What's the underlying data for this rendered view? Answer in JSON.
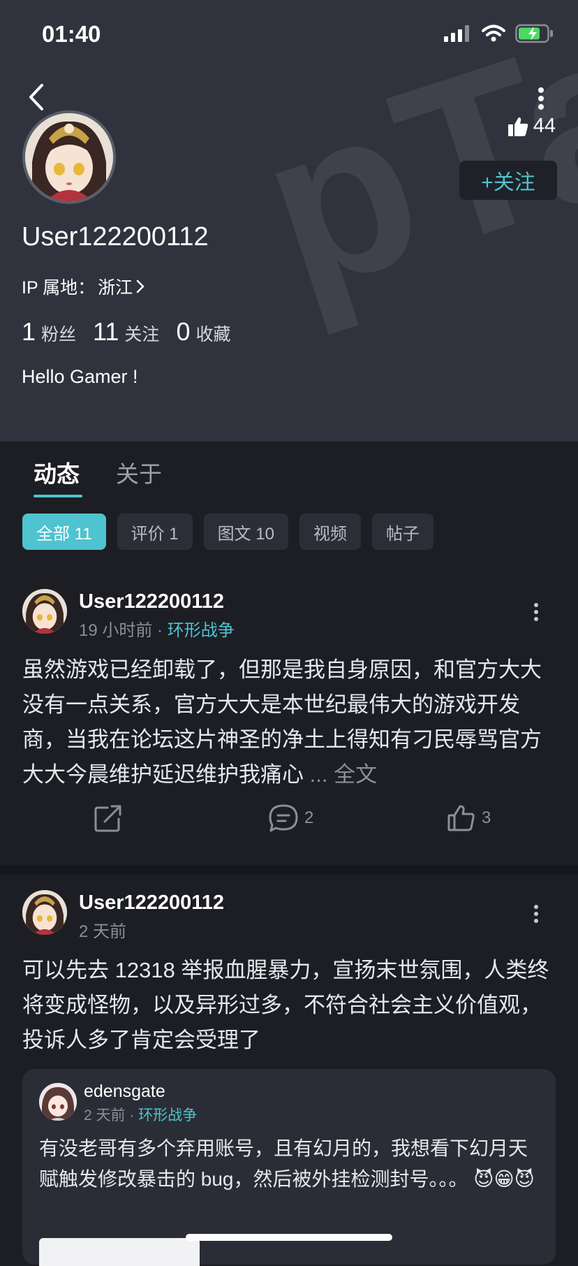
{
  "status_bar": {
    "time": "01:40"
  },
  "profile": {
    "likes": "44",
    "follow_label": "+关注",
    "username": "User122200112",
    "ip_label": "IP 属地：",
    "ip_value": "浙江",
    "stats": [
      {
        "num": "1",
        "label": "粉丝"
      },
      {
        "num": "11",
        "label": "关注"
      },
      {
        "num": "0",
        "label": "收藏"
      }
    ],
    "bio": "Hello Gamer !"
  },
  "tabs": {
    "active": "动态",
    "inactive": "关于"
  },
  "filters": [
    "全部 11",
    "评价 1",
    "图文 10",
    "视频",
    "帖子"
  ],
  "posts": [
    {
      "author": "User122200112",
      "time": "19 小时前",
      "sep": "·",
      "game": "环形战争",
      "text": "虽然游戏已经卸载了，但那是我自身原因，和官方大大没有一点关系，官方大大是本世纪最伟大的游戏开发商，当我在论坛这片神圣的净土上得知有刁民辱骂官方大大今晨维护延迟维护我痛心",
      "more": " ... 全文",
      "comments": "2",
      "likes": "3"
    },
    {
      "author": "User122200112",
      "time": "2 天前",
      "text": "可以先去 12318 举报血腥暴力，宣扬末世氛围，人类终将变成怪物，以及异形过多，不符合社会主义价值观，投诉人多了肯定会受理了",
      "quote": {
        "author": "edensgate",
        "time": "2 天前",
        "sep": "·",
        "game": "环形战争",
        "text": "有没老哥有多个弃用账号，且有幻月的，我想看下幻月天赋触发修改暴击的 bug，然后被外挂检测封号。。。",
        "emojis": "😈😁😈"
      }
    }
  ],
  "colors": {
    "accent": "#4fc3cf",
    "header_bg": "#30333d",
    "page_bg": "#1c1e24"
  }
}
